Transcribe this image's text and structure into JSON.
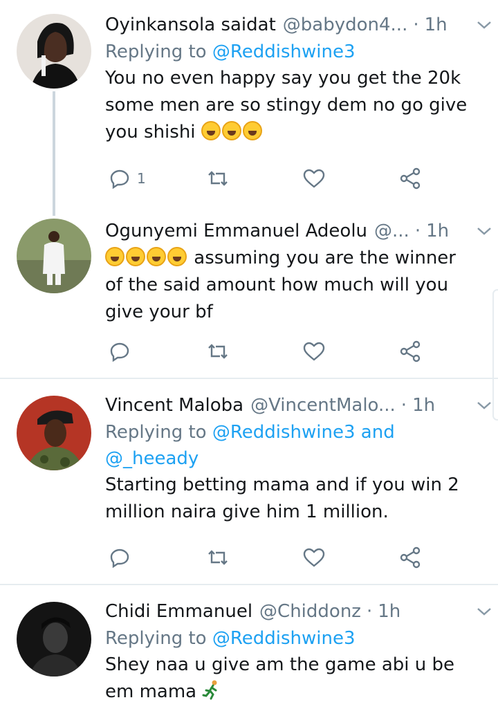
{
  "tweets": [
    {
      "name": "Oyinkansola saidat",
      "handle": "@babydon4...",
      "sep": "·",
      "time": "1h",
      "reply_prefix": "Replying to",
      "reply_mention": "@Reddishwine3",
      "reply_mention2": "",
      "text_lines": [
        "You no even happy say you get the 20k",
        "some men are so stingy dem no go give",
        "you shishi"
      ],
      "reply_count": "1",
      "avatar_color": "#d9d3cf"
    },
    {
      "name": "Ogunyemi Emmanuel Adeolu",
      "handle": "@...",
      "sep": "·",
      "time": "1h",
      "text_lines": [
        "assuming you are the winner",
        "of the said amount how much will you",
        "give your bf"
      ],
      "reply_count": "",
      "avatar_color": "#7a8a5a"
    },
    {
      "name": "Vincent Maloba",
      "handle": "@VincentMalo...",
      "sep": "·",
      "time": "1h",
      "reply_prefix": "Replying to",
      "reply_mention": "@Reddishwine3 and",
      "reply_mention2": "@_heeady",
      "text_lines": [
        "Starting betting mama and if you win 2",
        "million naira give him 1 million."
      ],
      "reply_count": "",
      "avatar_color": "#b23a2a"
    },
    {
      "name": "Chidi Emmanuel",
      "handle": "@Chiddonz",
      "sep": "·",
      "time": "1h",
      "reply_prefix": "Replying to",
      "reply_mention": "@Reddishwine3",
      "text_lines": [
        "Shey naa u give am the game abi u be",
        "em mama"
      ],
      "reply_count": "",
      "avatar_color": "#1a1a1a"
    }
  ],
  "colors": {
    "text": "#14171a",
    "muted": "#657786",
    "link": "#1da1f2",
    "divider": "#e6ecf0"
  },
  "icons": [
    "reply-icon",
    "retweet-icon",
    "like-icon",
    "share-icon",
    "caret-down-icon"
  ]
}
